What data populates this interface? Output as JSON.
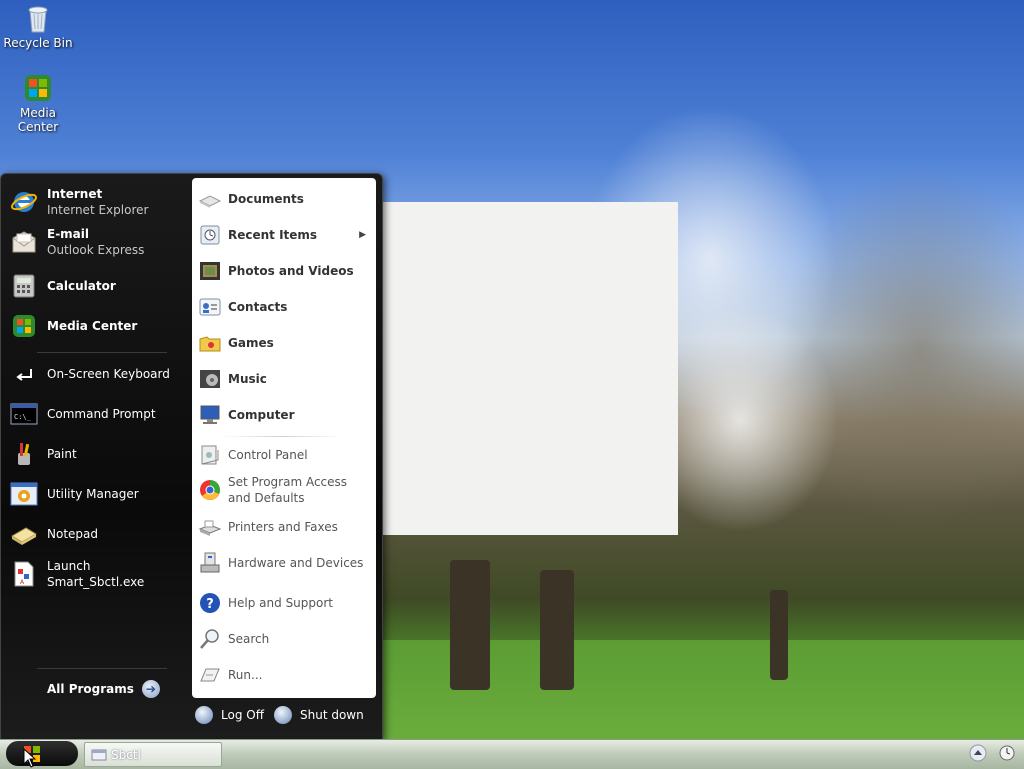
{
  "desktop": {
    "icons": [
      {
        "label": "Recycle Bin",
        "icon": "recycle-bin-icon"
      },
      {
        "label": "Media Center",
        "icon": "media-center-icon"
      }
    ]
  },
  "start_menu": {
    "pinned": [
      {
        "title": "Internet",
        "subtitle": "Internet Explorer",
        "icon": "internet-explorer-icon"
      },
      {
        "title": "E-mail",
        "subtitle": "Outlook Express",
        "icon": "email-icon"
      }
    ],
    "recent": [
      {
        "label": "Calculator",
        "icon": "calculator-icon",
        "bold": true
      },
      {
        "label": "Media Center",
        "icon": "media-center-icon",
        "bold": true
      },
      {
        "label": "On-Screen Keyboard",
        "icon": "keyboard-icon"
      },
      {
        "label": "Command Prompt",
        "icon": "command-prompt-icon"
      },
      {
        "label": "Paint",
        "icon": "paint-icon"
      },
      {
        "label": "Utility Manager",
        "icon": "utility-manager-icon"
      },
      {
        "label": "Notepad",
        "icon": "notepad-icon"
      },
      {
        "label": "Launch Smart_Sbctl.exe",
        "icon": "exe-icon"
      }
    ],
    "all_programs": "All Programs",
    "right_items": [
      {
        "label": "Documents",
        "icon": "documents-icon"
      },
      {
        "label": "Recent Items",
        "icon": "recent-items-icon",
        "submenu": true
      },
      {
        "label": "Photos and Videos",
        "icon": "photos-icon"
      },
      {
        "label": "Contacts",
        "icon": "contacts-icon"
      },
      {
        "label": "Games",
        "icon": "games-icon"
      },
      {
        "label": "Music",
        "icon": "music-icon"
      },
      {
        "label": "Computer",
        "icon": "computer-icon"
      },
      {
        "label": "Control Panel",
        "icon": "control-panel-icon"
      },
      {
        "label": "Set Program Access and Defaults",
        "icon": "program-defaults-icon"
      },
      {
        "label": "Printers and Faxes",
        "icon": "printer-icon"
      },
      {
        "label": "Hardware and Devices",
        "icon": "hardware-icon"
      },
      {
        "label": "Help and Support",
        "icon": "help-icon"
      },
      {
        "label": "Search",
        "icon": "search-icon"
      },
      {
        "label": "Run...",
        "icon": "run-icon"
      }
    ],
    "log_off": "Log Off",
    "shut_down": "Shut down"
  },
  "taskbar": {
    "task_label": "Sbctl"
  },
  "colors": {
    "menu_bg": "#0f0f0f",
    "right_pane_bg": "#ffffff",
    "taskbar_bg": "#bfcab8"
  }
}
